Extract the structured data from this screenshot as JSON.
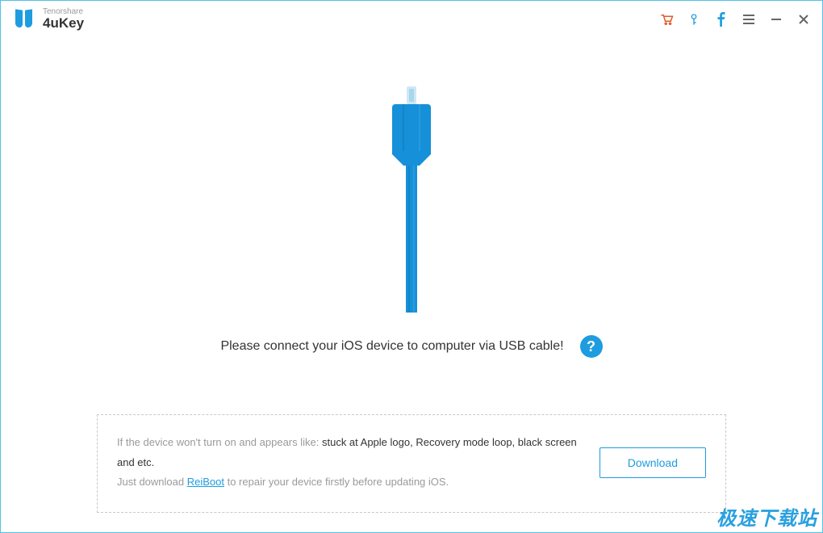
{
  "brand": {
    "company": "Tenorshare",
    "product": "4uKey"
  },
  "titlebar": {
    "cart_icon": "cart-icon",
    "key_icon": "key-icon",
    "facebook_icon": "facebook-icon",
    "menu_icon": "menu-icon",
    "minimize_icon": "minimize-icon",
    "close_icon": "close-icon"
  },
  "main": {
    "prompt": "Please connect your iOS device to computer via USB cable!",
    "help_label": "?"
  },
  "hint": {
    "line1_gray": "If the device won't turn on and appears like:",
    "line1_rest": " stuck at Apple logo, Recovery mode loop, black screen and etc.",
    "line2_gray_pre": "Just download ",
    "line2_link": "ReiBoot",
    "line2_gray_post": " to repair your device firstly before updating iOS.",
    "download_label": "Download"
  },
  "watermark": "极速下载站"
}
